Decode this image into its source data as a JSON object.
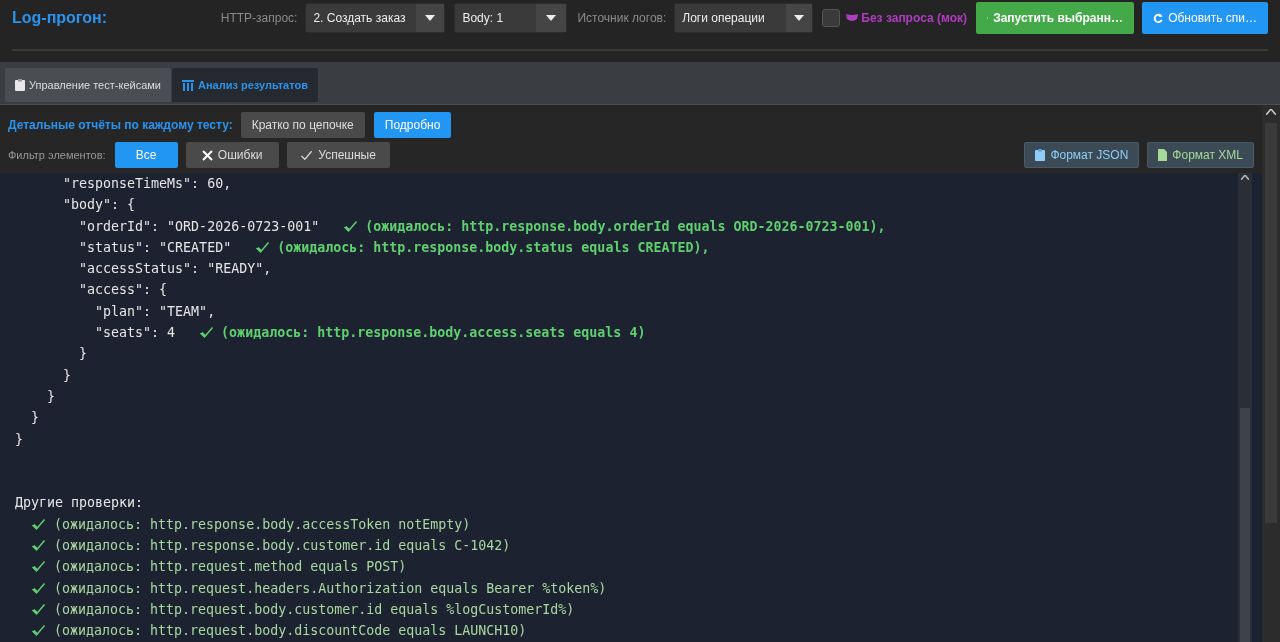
{
  "title": "Log-прогон:",
  "toolbar": {
    "http_label": "HTTP-запрос:",
    "http_select": "2. Создать заказ",
    "body_select": "Body: 1",
    "log_label": "Источник логов:",
    "log_select": "Логи операции",
    "mock": {
      "label": "Без запроса (мок)",
      "checked": false
    },
    "run_button": "Запустить выбранн…",
    "refresh_button": "Обновить спи…"
  },
  "tabs": [
    {
      "label": "Управление тест-кейсами",
      "selected": false
    },
    {
      "label": "Анализ результатов",
      "selected": true
    }
  ],
  "report_mode": {
    "label": "Детальные отчёты по каждому тесту:",
    "options": [
      {
        "label": "Кратко по цепочке",
        "selected": false
      },
      {
        "label": "Подробно",
        "selected": true
      }
    ]
  },
  "filter": {
    "label": "Фильтр элементов:",
    "options": [
      {
        "kind": "all",
        "label": "Все",
        "selected": true
      },
      {
        "kind": "errors",
        "label": "Ошибки",
        "selected": false
      },
      {
        "kind": "success",
        "label": "Успешные",
        "selected": false
      }
    ]
  },
  "export_buttons": [
    {
      "kind": "json",
      "label": "Формат JSON"
    },
    {
      "kind": "xml",
      "label": "Формат XML"
    }
  ],
  "code_lines": [
    {
      "code": "      \"responseTimeMs\": 60,"
    },
    {
      "code": "      \"body\": {"
    },
    {
      "code": "        \"orderId\": \"ORD-2026-0723-001\"",
      "check": {
        "passed": true,
        "text": "(ожидалось: http.response.body.orderId equals ORD-2026-0723-001),"
      }
    },
    {
      "code": "        \"status\": \"CREATED\"",
      "check": {
        "passed": true,
        "text": "(ожидалось: http.response.body.status equals CREATED),"
      }
    },
    {
      "code": "        \"accessStatus\": \"READY\","
    },
    {
      "code": "        \"access\": {"
    },
    {
      "code": "          \"plan\": \"TEAM\","
    },
    {
      "code": "          \"seats\": 4",
      "check": {
        "passed": true,
        "text": "(ожидалось: http.response.body.access.seats equals 4)"
      }
    },
    {
      "code": "        }"
    },
    {
      "code": "      }"
    },
    {
      "code": "    }"
    },
    {
      "code": "  }"
    },
    {
      "code": "}"
    }
  ],
  "other_checks": {
    "title": "Другие проверки:",
    "items": [
      {
        "passed": true,
        "text": "(ожидалось: http.response.body.accessToken notEmpty)"
      },
      {
        "passed": true,
        "text": "(ожидалось: http.response.body.customer.id equals C-1042)"
      },
      {
        "passed": true,
        "text": "(ожидалось: http.request.method equals POST)"
      },
      {
        "passed": true,
        "text": "(ожидалось: http.request.headers.Authorization equals Bearer %token%)"
      },
      {
        "passed": true,
        "text": "(ожидалось: http.request.body.customer.id equals %logCustomerId%)"
      },
      {
        "passed": true,
        "text": "(ожидалось: http.request.body.discountCode equals LAUNCH10)"
      }
    ]
  }
}
